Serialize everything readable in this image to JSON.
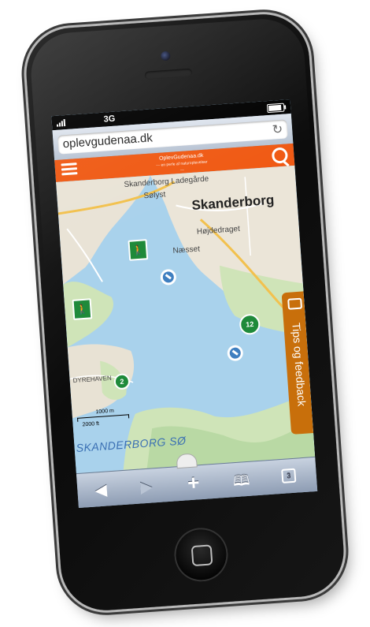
{
  "status_bar": {
    "carrier_signal": "signal-bars-icon",
    "network": "3G",
    "battery": "battery-icon"
  },
  "browser": {
    "url": "oplevgudenaa.dk",
    "reload_icon": "reload-icon"
  },
  "site_header": {
    "menu_icon": "hamburger-menu-icon",
    "logo_title": "OplevGudenaa.dk",
    "logo_subtitle": "— en perle af naturoplevelser —",
    "search_icon": "search-icon",
    "brand_color": "#f05a14"
  },
  "map": {
    "labels": {
      "skanderborg_ladegaard": "Skanderborg Ladegårde",
      "solyst": "Sølyst",
      "skanderborg": "Skanderborg",
      "hojdedraget": "Højdedraget",
      "naesset": "Næsset",
      "lake": "SKANDERBORG SØ",
      "district": "DYREHAVEN"
    },
    "clusters": {
      "large": "12",
      "small": "2"
    },
    "scale": {
      "metric": "1000 m",
      "imperial": "2000 ft"
    }
  },
  "feedback": {
    "label": "Tips og feedback",
    "icon": "megaphone-icon",
    "color": "#c86f0b"
  },
  "toolbar": {
    "back": "◀",
    "forward": "▶",
    "add": "+",
    "bookmarks": "𝕄",
    "pages_count": "3"
  }
}
